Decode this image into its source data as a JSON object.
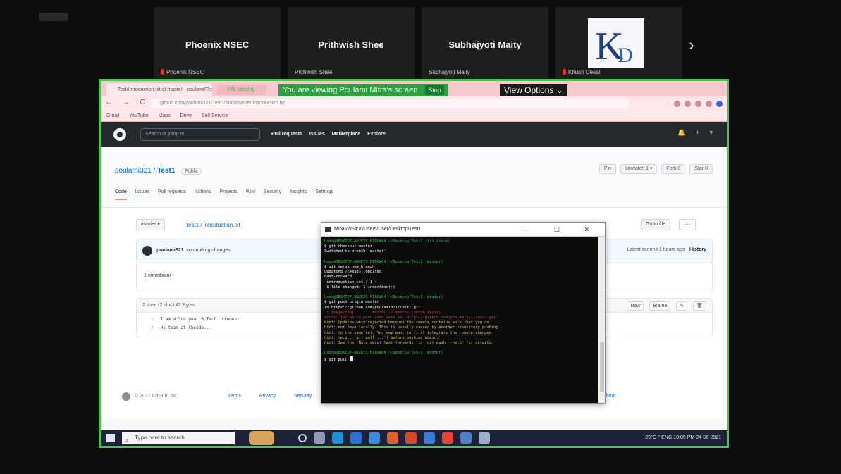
{
  "meeting": {
    "corner_badge": "",
    "participants": [
      {
        "name": "Phoenix NSEC",
        "label": "Phoenix NSEC",
        "muted": true
      },
      {
        "name": "Prithwish Shee",
        "label": "Prithwish Shee",
        "muted": false
      },
      {
        "name": "Subhajyoti Maity",
        "label": "Subhajyoti Maity",
        "muted": false
      },
      {
        "name": "",
        "label": "Khush Desai",
        "muted": true
      }
    ],
    "next_symbol": "›",
    "logo_text": "KD"
  },
  "share": {
    "banner_text": "You are viewing Poulami Mitra's screen",
    "stop_label": "Stop",
    "view_options_label": "View Options ⌄"
  },
  "browser": {
    "tab1_title": "Test/Introduction.txt at master · poulami/Test1",
    "tab2_title": "Y75 Meeting",
    "url": "github.com/poulami321/Test1/blob/master/introduction.txt",
    "nav_icons": "← → C",
    "bookmarks": [
      "Gmail",
      "YouTube",
      "Maps",
      "Drive",
      "Self Service"
    ]
  },
  "github": {
    "search_placeholder": "Search or jump to...",
    "nav": [
      "Pull requests",
      "Issues",
      "Marketplace",
      "Explore"
    ],
    "right_icons": "🔔 + ▾",
    "repo_owner": "poulami321",
    "repo_sep": " / ",
    "repo_name": "Test1",
    "visibility": "Public",
    "repo_buttons": [
      "Pin",
      "Unwatch 1 ▾",
      "Fork 0",
      "Star 0"
    ],
    "tabs": [
      "Code",
      "Issues",
      "Pull requests",
      "Actions",
      "Projects",
      "Wiki",
      "Security",
      "Insights",
      "Settings"
    ],
    "branch": "master ▾",
    "breadcrumb": "Test1 / introduction.txt",
    "goto_label": "Go to file",
    "more_label": "···",
    "commit_author": "poulami321",
    "commit_message": "committing changes",
    "commit_time": "Latest commit 1 hours ago",
    "history_label": "History",
    "contributors": "1 contributor",
    "file_meta": "2 lines (2 sloc)   42 Bytes",
    "file_actions": [
      "Raw",
      "Blame",
      "✎",
      "🗑"
    ],
    "code_lines": [
      {
        "ln": "1",
        "text": "I am a 3rd year B.Tech. student"
      },
      {
        "ln": "2",
        "text": "Hi team at Cbcode..."
      }
    ],
    "footer_copy": "© 2021 GitHub, Inc.",
    "footer_links": [
      "Terms",
      "Privacy",
      "Security"
    ],
    "footer_right": "About"
  },
  "terminal": {
    "title": "MINGW64:/c/Users/User/Desktop/Test1",
    "window_buttons": "— ☐ ✕",
    "lines": [
      {
        "c": "g",
        "t": "User@DESKTOP-AN2E7S MINGW64 ~/Desktop/Test1 (fix_issue)"
      },
      {
        "c": "w",
        "t": "$ git checkout master"
      },
      {
        "c": "w",
        "t": "Switched to branch 'master'"
      },
      {
        "c": "w",
        "t": ""
      },
      {
        "c": "g",
        "t": "User@DESKTOP-AN2E7S MINGW64 ~/Desktop/Test1 (master)"
      },
      {
        "c": "w",
        "t": "$ git merge new_branch"
      },
      {
        "c": "w",
        "t": "Updating 7c4e5d3..0bd1fe0"
      },
      {
        "c": "w",
        "t": "Fast-forward"
      },
      {
        "c": "w",
        "t": " introduction.txt | 1 +"
      },
      {
        "c": "w",
        "t": " 1 file changed, 1 insertion(+)"
      },
      {
        "c": "w",
        "t": ""
      },
      {
        "c": "g",
        "t": "User@DESKTOP-AN2E7S MINGW64 ~/Desktop/Test1 (master)"
      },
      {
        "c": "w",
        "t": "$ git push origin master"
      },
      {
        "c": "w",
        "t": "To https://github.com/poulami321/Test1.git"
      },
      {
        "c": "r",
        "t": " ! [rejected]        master -> master (fetch first)"
      },
      {
        "c": "r",
        "t": "error: failed to push some refs to 'https://github.com/poulami321/Test1.git'"
      },
      {
        "c": "y",
        "t": "hint: Updates were rejected because the remote contains work that you do"
      },
      {
        "c": "y",
        "t": "hint: not have locally. This is usually caused by another repository pushing"
      },
      {
        "c": "y",
        "t": "hint: to the same ref. You may want to first integrate the remote changes"
      },
      {
        "c": "y",
        "t": "hint: (e.g., 'git pull ...') before pushing again."
      },
      {
        "c": "y",
        "t": "hint: See the 'Note about fast-forwards' in 'git push --help' for details."
      },
      {
        "c": "w",
        "t": ""
      },
      {
        "c": "g",
        "t": "User@DESKTOP-AN2E7S MINGW64 ~/Desktop/Test1 (master)"
      },
      {
        "c": "w",
        "t": "$ git pull"
      }
    ]
  },
  "taskbar": {
    "search_placeholder": "Type here to search",
    "tray_text": "29°C  ^  ENG  10:05 PM  04-06-2021"
  },
  "colors": {
    "share_border": "#4cc14b",
    "github_header": "#24292e",
    "taskbar": "#1c2238"
  }
}
